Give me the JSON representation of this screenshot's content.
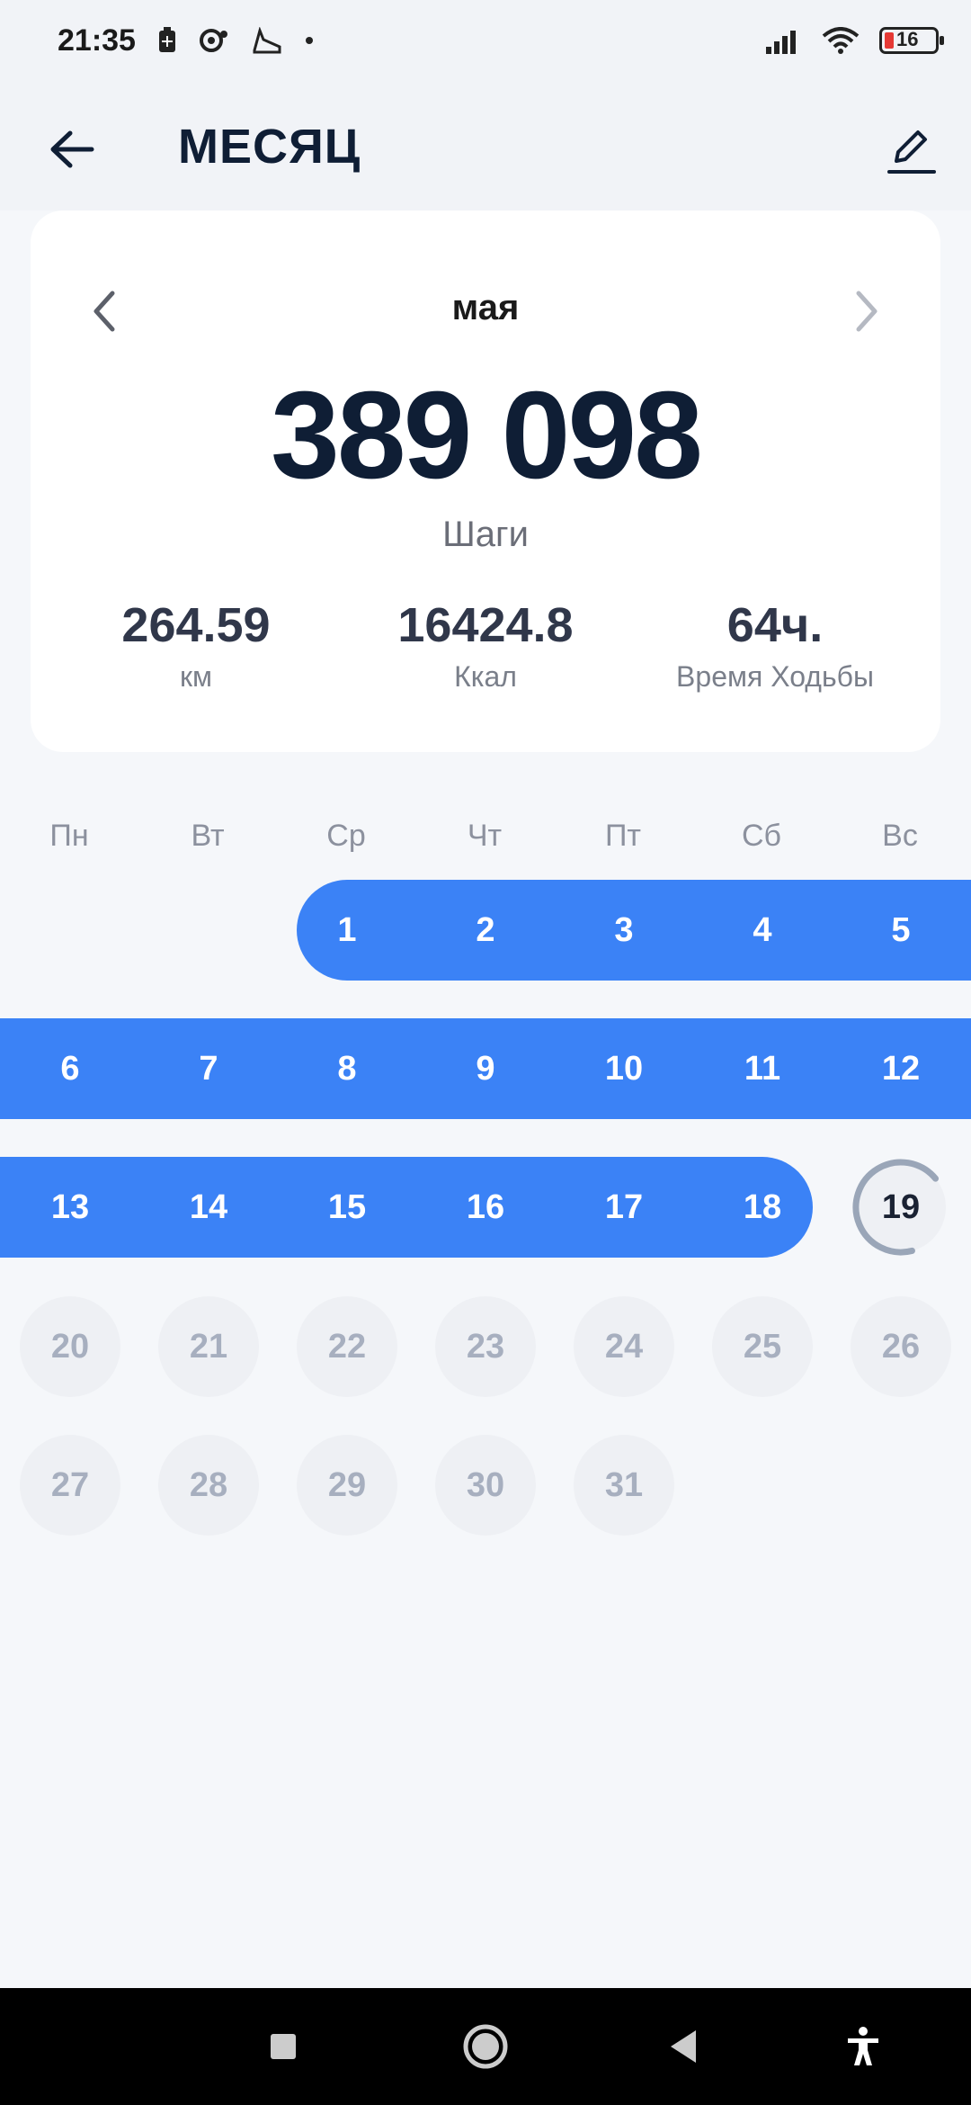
{
  "status_bar": {
    "time": "21:35",
    "battery": "16",
    "icons": [
      "battery-saver-icon",
      "record-icon",
      "shoe-icon",
      "dot-icon",
      "signal-icon",
      "wifi-icon",
      "battery-icon"
    ]
  },
  "header": {
    "title": "МЕСЯЦ",
    "back_icon": "arrow-left-icon",
    "edit_icon": "pencil-icon"
  },
  "summary": {
    "month": "мая",
    "steps_value": "389 098",
    "steps_label": "Шаги",
    "stats": [
      {
        "value": "264.59",
        "label": "км"
      },
      {
        "value": "16424.8",
        "label": "Ккал"
      },
      {
        "value": "64ч.",
        "label": "Время Ходьбы"
      }
    ]
  },
  "calendar": {
    "weekdays": [
      "Пн",
      "Вт",
      "Ср",
      "Чт",
      "Пт",
      "Сб",
      "Вс"
    ],
    "days": [
      "1",
      "2",
      "3",
      "4",
      "5",
      "6",
      "7",
      "8",
      "9",
      "10",
      "11",
      "12",
      "13",
      "14",
      "15",
      "16",
      "17",
      "18",
      "19",
      "20",
      "21",
      "22",
      "23",
      "24",
      "25",
      "26",
      "27",
      "28",
      "29",
      "30",
      "31"
    ],
    "completed_through": 18,
    "today": 19,
    "today_progress": 0.35
  },
  "colors": {
    "accent": "#3B82F6",
    "text_dark": "#0F1E35",
    "future_bg": "#EEF0F4"
  }
}
